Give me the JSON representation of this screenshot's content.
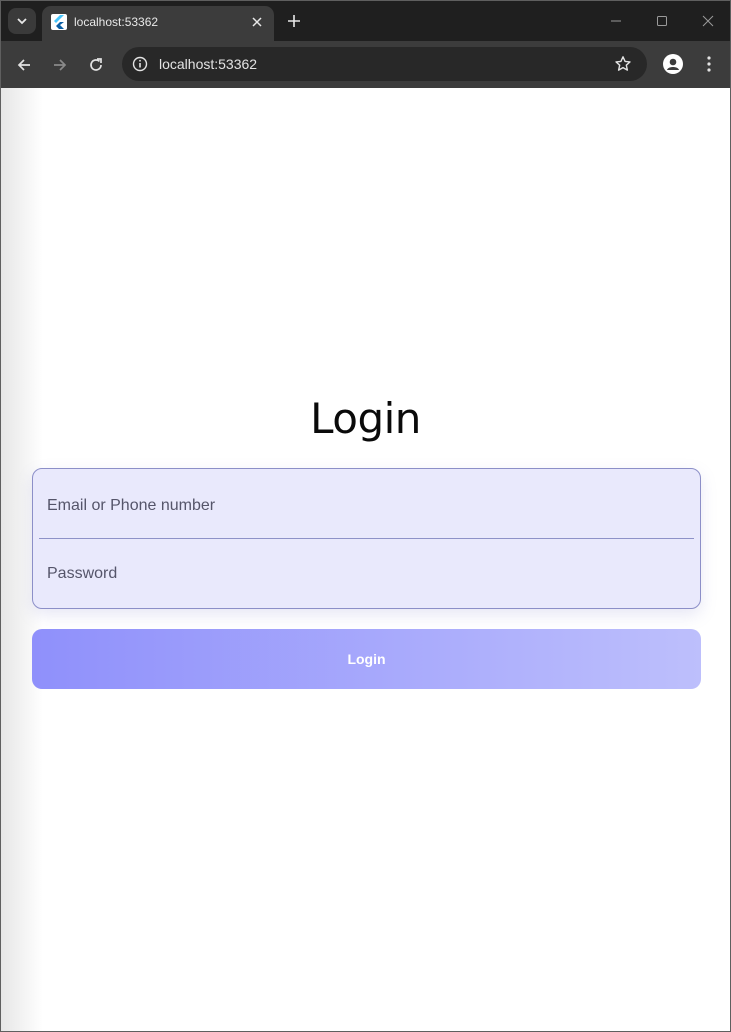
{
  "browser": {
    "tab_title": "localhost:53362",
    "url": "localhost:53362",
    "icons": {
      "tab_search": "chevron-down-icon",
      "favicon": "flutter-icon",
      "tab_close": "close-icon",
      "new_tab": "plus-icon",
      "minimize": "minimize-icon",
      "maximize": "maximize-icon",
      "window_close": "close-icon",
      "back": "arrow-left-icon",
      "forward": "arrow-right-icon",
      "reload": "reload-icon",
      "site_info": "info-icon",
      "bookmark": "star-icon",
      "profile": "profile-icon",
      "menu": "kebab-menu-icon"
    }
  },
  "login": {
    "title": "Login",
    "email_placeholder": "Email or Phone number",
    "email_value": "",
    "password_placeholder": "Password",
    "password_value": "",
    "button_label": "Login"
  },
  "colors": {
    "tab_strip": "#1f1f1f",
    "toolbar": "#3c3c3c",
    "form_background": "#e9e9fc",
    "form_border": "#8c8fc8",
    "button_gradient_start": "#8f90fb",
    "button_gradient_end": "#bdbffc"
  }
}
